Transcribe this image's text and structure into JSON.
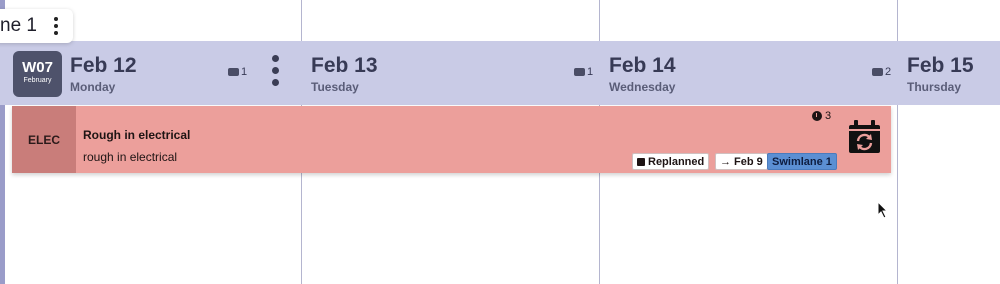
{
  "swimlane": {
    "label": "ne 1"
  },
  "week": {
    "number": "W07",
    "month": "February"
  },
  "days": [
    {
      "date": "Feb 12",
      "weekday": "Monday",
      "count": "1"
    },
    {
      "date": "Feb 13",
      "weekday": "Tuesday",
      "count": "1"
    },
    {
      "date": "Feb 14",
      "weekday": "Wednesday",
      "count": "2"
    },
    {
      "date": "Feb 15",
      "weekday": "Thursday",
      "count": ""
    }
  ],
  "task": {
    "trade": "ELEC",
    "title": "Rough in electrical",
    "description": "rough in electrical",
    "duration": "3",
    "tags": {
      "replanned": "Replanned",
      "moved_from": "Feb 9",
      "swimlane": "Swimlane 1"
    }
  },
  "colors": {
    "header_bg": "#c9cbe6",
    "week_badge": "#4e526b",
    "task_bg": "#ec9f9b",
    "trade_bg": "#c97d7a",
    "swimlane_tag": "#5b8fd3"
  }
}
